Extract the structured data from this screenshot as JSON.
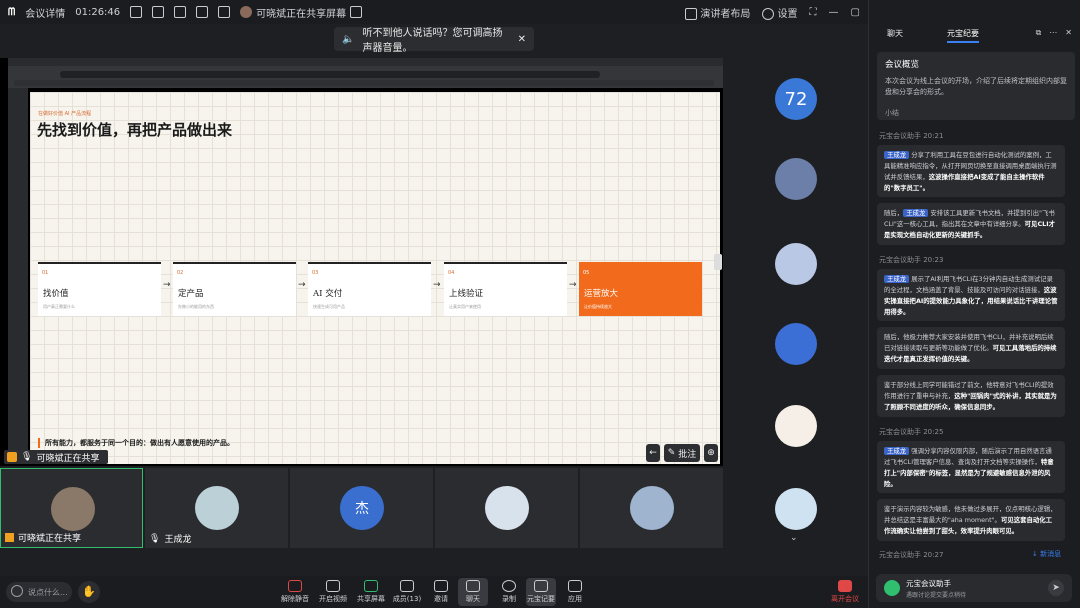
{
  "topbar": {
    "meeting_details": "会议详情",
    "timer": "01:26:46",
    "sharing_status": "可晓斌正在共享屏幕",
    "presenter_layout": "演讲者布局",
    "settings": "设置"
  },
  "notice": {
    "text": "听不到他人说话吗？您可调高扬声器音量。"
  },
  "slide": {
    "kicker": "在做好价值 AI 产品流程",
    "title": "先找到价值，再把产品做出来",
    "steps": [
      {
        "num": "01",
        "title": "找价值",
        "sub": "用户真正需要什么"
      },
      {
        "num": "02",
        "title": "定产品",
        "sub": "先做小的能用的东西"
      },
      {
        "num": "03",
        "title": "AI 交付",
        "sub": "快速生成可用产品"
      },
      {
        "num": "04",
        "title": "上线验证",
        "sub": "让真实用户来使用"
      },
      {
        "num": "05",
        "title": "运营放大",
        "sub": "让价值持续放大"
      }
    ],
    "footer": "所有能力，都服务于同一个目的：做出有人愿意使用的产品。"
  },
  "share_overlay": {
    "sharer_label": "可晓斌正在共享",
    "annotate": "批注"
  },
  "participants_side": {
    "count_badge": "72"
  },
  "participants": [
    {
      "name": "可晓斌正在共享"
    },
    {
      "name": "王成龙"
    },
    {
      "name": ""
    },
    {
      "name": ""
    },
    {
      "name": ""
    }
  ],
  "tile_initial": "杰",
  "toolbar": {
    "input_placeholder": "说点什么...",
    "buttons": [
      "解除静音",
      "开启视频",
      "共享屏幕",
      "成员(13)",
      "邀请",
      "聊天",
      "录制",
      "元宝记要",
      "应用"
    ],
    "leave": "离开会议"
  },
  "panel": {
    "tabs": [
      "聊天",
      "元宝纪要"
    ],
    "summary_title": "会议概览",
    "summary_body": "本次会议为线上会议的开场，介绍了后续将定期组织内部复盘和分享会的形式。",
    "summary_more": "小结",
    "messages": [
      {
        "header": "元宝会议助手 20:21",
        "name": "王成龙",
        "text": "分享了利用工具在豆包进行自动化测试的案例，工具能精准响应指令，从打开网页切换至直接调用桌面端执行测试并反馈结果，",
        "bold": "这波操作直接把AI变成了能自主操作软件的\"数字员工\"。"
      },
      {
        "header": "",
        "name": "王成龙",
        "pre": "随后，",
        "text": "安排该工具更新飞书文档，并提到引出\"飞书CLI\"这一核心工具，指出其在文章中有详细分享。",
        "bold": "可见CLI才是实现文档自动化更新的关键抓手。"
      },
      {
        "header": "元宝会议助手 20:23",
        "name": "王成龙",
        "text": "展示了AI利用飞书CLI在3分钟内自动生成测试记录的全过程，文档涵盖了背景、技能及可访问的对话链接，",
        "bold": "这波实操直接把AI的提效能力具象化了，用结果说话比干讲理论管用得多。"
      },
      {
        "header": "",
        "name": "",
        "pre": "随后，他极力推荐大家安装并使用飞书CLI，并补充说明后续已对链接读取与更新等功能做了优化。",
        "text": "",
        "bold": "可见工具落地后的持续迭代才是真正发挥价值的关键。"
      },
      {
        "header": "",
        "name": "",
        "pre": "鉴于部分线上同学可能错过了前文，他特意对飞书CLI的提效作用进行了重申与补充，",
        "text": "",
        "bold": "这种\"回锅肉\"式的补讲，其实就是为了照顾不同进度的听众，确保信息同步。"
      },
      {
        "header": "元宝会议助手 20:25",
        "name": "王成龙",
        "text": "强调分享内容仅限内部，随后演示了用自然语言通过飞书CLI管理客户信息、查询及打开文档等实操操作，",
        "bold": "特意打上\"内部保密\"的标签，显然是为了规避敏感信息外泄的风险。"
      },
      {
        "header": "",
        "name": "",
        "pre": "鉴于演示内容较为敏感，他未做过多展开，仅点明核心逻辑，并总结这是丰富最大的\"aha moment\"。",
        "text": "",
        "bold": "可见这套自动化工作流确实让他尝到了甜头，效率提升肉眼可见。"
      }
    ],
    "last_header": "元宝会议助手 20:27",
    "new_messages": "新消息",
    "assistant_name": "元宝会议助手",
    "assistant_status": "遇跟讨论提交要点稍待"
  }
}
